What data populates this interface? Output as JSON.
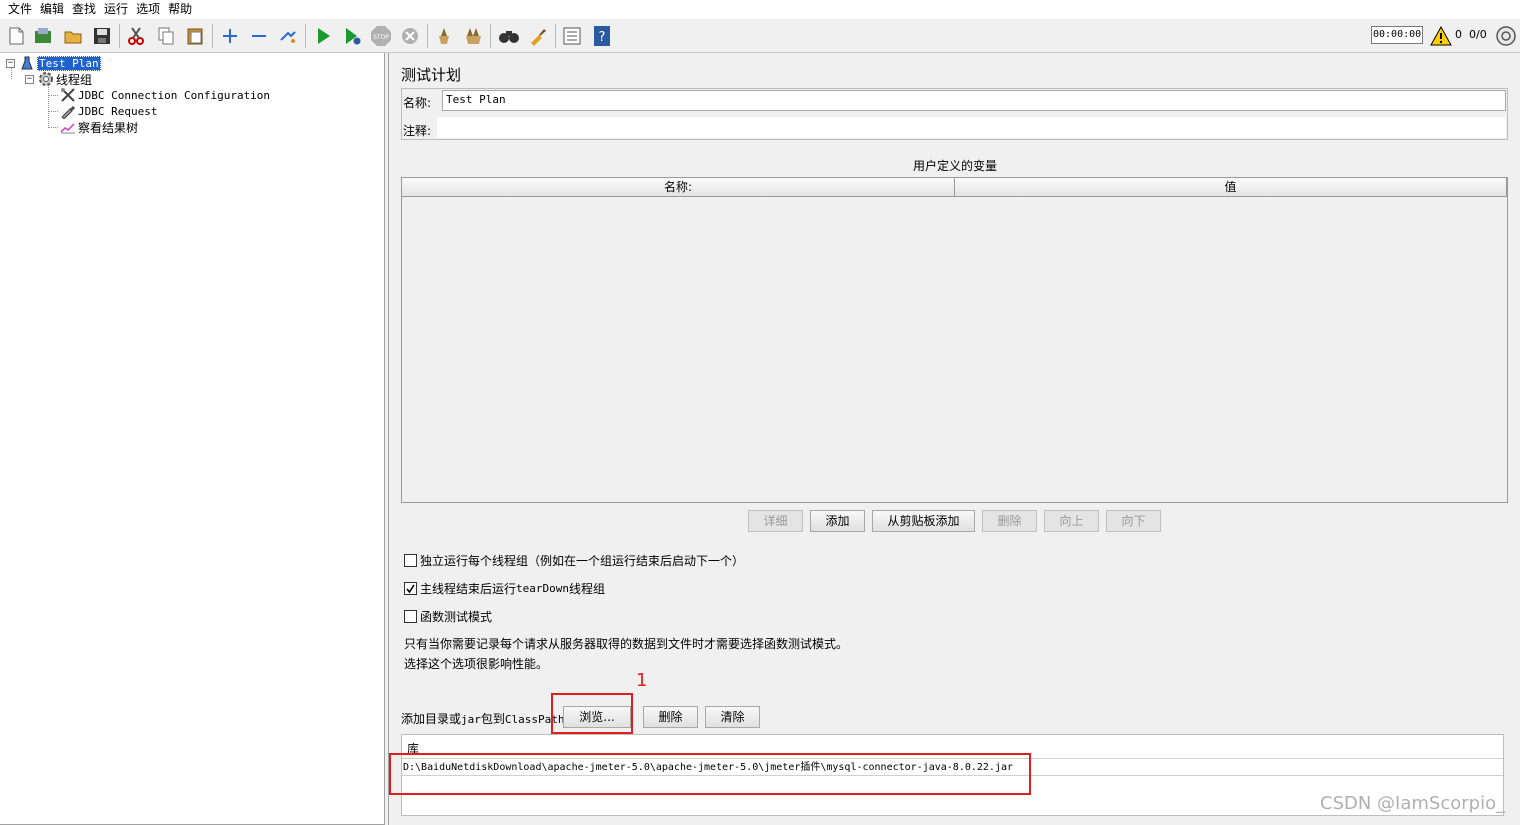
{
  "menu": [
    "文件",
    "编辑",
    "查找",
    "运行",
    "选项",
    "帮助"
  ],
  "toolbar": {
    "icons": [
      "new-icon",
      "templates-icon",
      "open-icon",
      "save-icon",
      "cut-icon",
      "copy-icon",
      "paste-icon",
      "expand-icon",
      "collapse-icon",
      "toggle-icon",
      "start-icon",
      "start-no-pause-icon",
      "stop-icon",
      "shutdown-icon",
      "clear-icon",
      "clear-all-icon",
      "search-icon",
      "reset-search-icon",
      "function-helper-icon",
      "help-icon"
    ],
    "timer": "00:00:00",
    "warning_count": "0",
    "threads": "0/0"
  },
  "tree": {
    "items": [
      {
        "label": "Test Plan"
      },
      {
        "label": "线程组"
      },
      {
        "label": "JDBC Connection Configuration"
      },
      {
        "label": "JDBC Request"
      },
      {
        "label": "察看结果树"
      }
    ]
  },
  "panel": {
    "title": "测试计划",
    "name_label": "名称:",
    "name_value": "Test Plan",
    "comment_label": "注释:",
    "comment_value": "",
    "vars_title": "用户定义的变量",
    "vars_columns": [
      "名称:",
      "值"
    ],
    "buttons": {
      "detail": "详细",
      "add": "添加",
      "add_clipboard": "从剪贴板添加",
      "delete": "删除",
      "up": "向上",
      "down": "向下"
    },
    "options": {
      "serialize": "独立运行每个线程组（例如在一个组运行结束后启动下一个）",
      "teardown_prefix": "主线程结束后运行 ",
      "teardown_mono": "tearDown",
      "teardown_suffix": "线程组",
      "functional": "函数测试模式"
    },
    "functional_note_1": "只有当你需要记录每个请求从服务器取得的数据到文件时才需要选择函数测试模式。",
    "functional_note_2": "选择这个选项很影响性能。",
    "classpath_prefix": "添加目录或",
    "classpath_mono": "jar",
    "classpath_mid": "包到",
    "classpath_mono2": "ClassPath",
    "browse": "浏览...",
    "cp_delete": "删除",
    "cp_clear": "清除",
    "lib_header": "库",
    "lib_row": "D:\\BaiduNetdiskDownload\\apache-jmeter-5.0\\apache-jmeter-5.0\\jmeter插件\\mysql-connector-java-8.0.22.jar"
  },
  "annotation_number": "1",
  "watermark": "CSDN @IamScorpio_"
}
